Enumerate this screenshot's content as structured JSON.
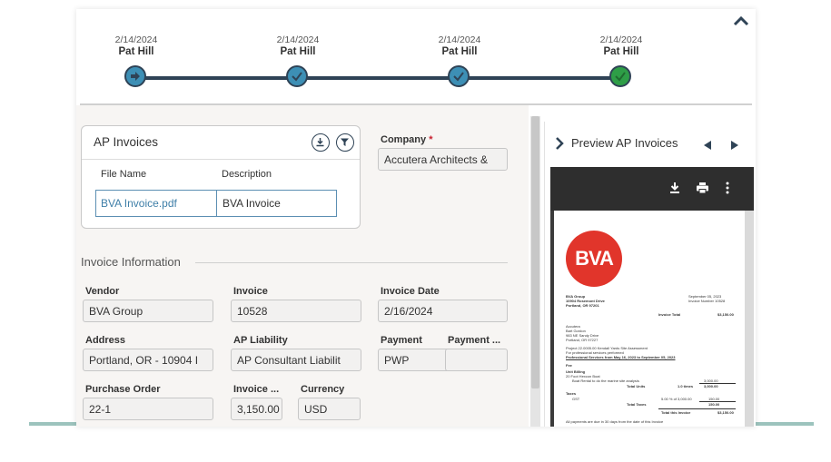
{
  "stepper": {
    "steps": [
      {
        "date": "2/14/2024",
        "name": "Pat Hill",
        "status": "forward"
      },
      {
        "date": "2/14/2024",
        "name": "Pat Hill",
        "status": "approved"
      },
      {
        "date": "2/14/2024",
        "name": "Pat Hill",
        "status": "approved"
      },
      {
        "date": "2/14/2024",
        "name": "Pat Hill",
        "status": "current"
      }
    ]
  },
  "ap_invoices": {
    "title": "AP Invoices",
    "columns": [
      "File Name",
      "Description"
    ],
    "rows": [
      {
        "file_name": "BVA Invoice.pdf",
        "description": "BVA Invoice"
      }
    ]
  },
  "company": {
    "label": "Company",
    "required_mark": "*",
    "value": "Accutera Architects &"
  },
  "invoice_info": {
    "section_title": "Invoice Information"
  },
  "fields": {
    "vendor": {
      "label": "Vendor",
      "value": "BVA Group"
    },
    "invoice": {
      "label": "Invoice",
      "value": "10528"
    },
    "invoice_date": {
      "label": "Invoice Date",
      "value": "2/16/2024"
    },
    "address": {
      "label": "Address",
      "value": "Portland, OR - 10904 I"
    },
    "ap_liability": {
      "label": "AP Liability",
      "value": "AP Consultant Liabilit"
    },
    "payment": {
      "label": "Payment",
      "value": "PWP"
    },
    "payment2": {
      "label": "Payment ...",
      "value": ""
    },
    "purchase_order": {
      "label": "Purchase Order",
      "value": "22-1"
    },
    "invoice_amount": {
      "label": "Invoice ...",
      "value": "3,150.00"
    },
    "currency": {
      "label": "Currency",
      "value": "USD"
    }
  },
  "preview": {
    "title": "Preview AP Invoices",
    "doc": {
      "logo": "BVA",
      "from_lines": [
        "BVA Group",
        "10904 Rosemont Drive",
        "Portland, OR 97201"
      ],
      "date_label": "September 05, 2023",
      "invoice_number": "Invoice Number  10528",
      "invoice_total_label": "Invoice Total",
      "invoice_total": "$3,150.00",
      "to_lines": [
        "Accutera",
        "Bart Gordon",
        "983 NE Sandy Drive",
        "Portland, OR 97227"
      ],
      "project_line": "Project         22.0005.00        Kendall Yards Site Assessment",
      "services_line": "For professional services performed",
      "period_line": "Professional Services from May 16, 2023 to September 05, 2023",
      "fee_label": "Fee",
      "unit_billing": "Unit Billing",
      "unit_item": "20 Foot Hexcon Boat",
      "unit_desc": "Boat Rental to do the marine site analysis",
      "total_units": "Total Units",
      "times": "1.0 times",
      "amount_1": "3,000.00",
      "amount_2": "3,000.00",
      "taxes": "Taxes",
      "gst": "GST",
      "gst_rate": "5.00 % of 3,000.00",
      "gst_amount": "150.00",
      "total_taxes": "Total Taxes",
      "total_taxes_amount": "150.00",
      "total_invoice": "Total this Invoice",
      "total_invoice_amount": "$3,150.00",
      "footer": "All payments are due in 30 days from the date of this Invoice"
    }
  },
  "colors": {
    "step_blue": "#3d8fb5",
    "step_green": "#2e9e47",
    "track": "#2f4356",
    "link": "#3f7fa8",
    "required": "#c8202f",
    "logo_red": "#e1352b"
  }
}
